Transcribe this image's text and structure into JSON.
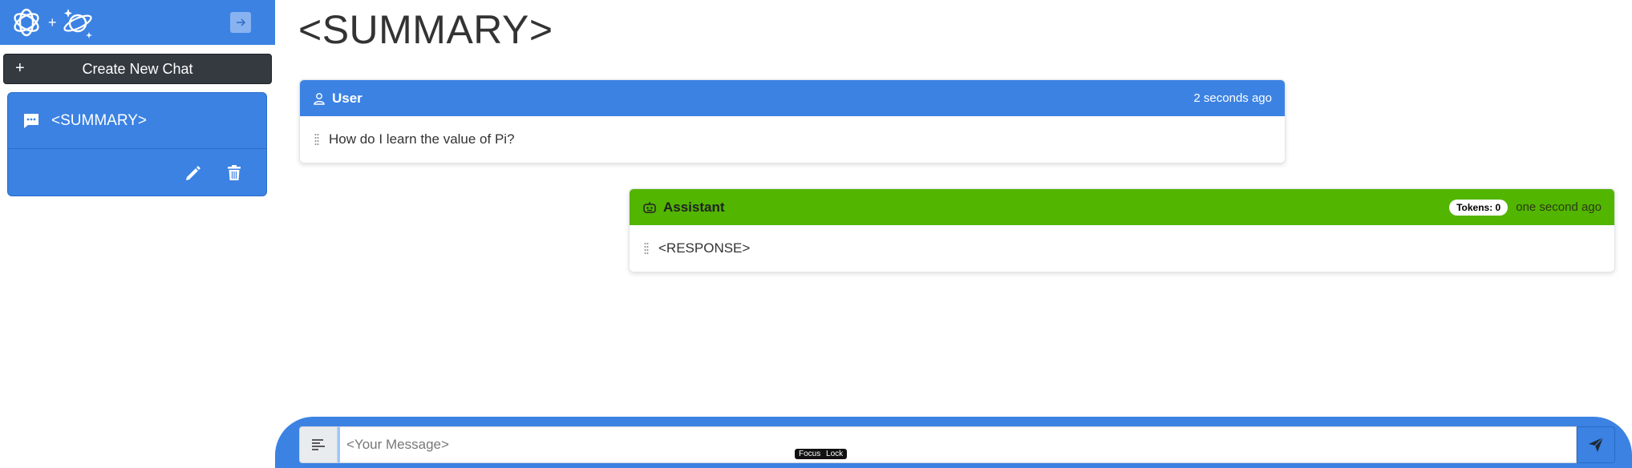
{
  "sidebar": {
    "brand_plus": "+",
    "new_chat_plus": "+",
    "new_chat_label": "Create New Chat",
    "chats": [
      {
        "title": "<SUMMARY>"
      }
    ]
  },
  "main": {
    "title": "<SUMMARY>",
    "messages": [
      {
        "role": "User",
        "time": "2 seconds ago",
        "text": "How do I learn the value of Pi?"
      },
      {
        "role": "Assistant",
        "tokens": "Tokens: 0",
        "time": "one second ago",
        "text": "<RESPONSE>"
      }
    ]
  },
  "composer": {
    "placeholder": "<Your Message>",
    "focus_lock": "Focus Lock"
  },
  "colors": {
    "primary": "#3b82e3",
    "assistant": "#52b500",
    "dark": "#343a40"
  },
  "icons": [
    "openai-logo-icon",
    "planet-sparkles-icon",
    "arrow-right-icon",
    "plus-icon",
    "chat-bubble-icon",
    "pencil-icon",
    "trash-icon",
    "user-icon",
    "robot-icon",
    "grip-icon",
    "text-format-icon",
    "send-icon"
  ]
}
